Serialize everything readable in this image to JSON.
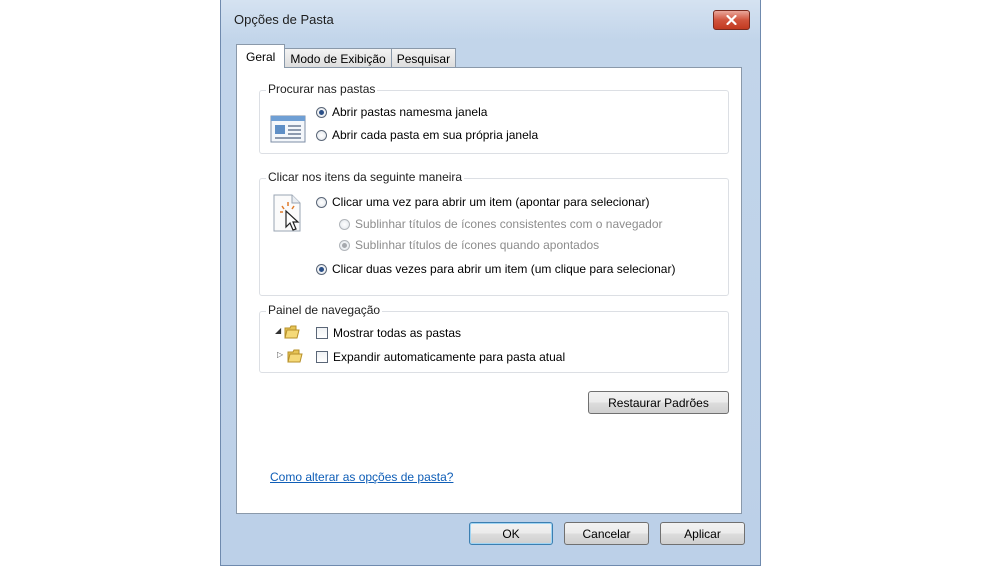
{
  "window": {
    "title": "Opções de Pasta"
  },
  "tabs": [
    {
      "label": "Geral",
      "active": true
    },
    {
      "label": "Modo de Exibição",
      "active": false
    },
    {
      "label": "Pesquisar",
      "active": false
    }
  ],
  "browse_group": {
    "title": "Procurar nas pastas",
    "options": [
      {
        "label": "Abrir pastas namesma janela",
        "selected": true
      },
      {
        "label": "Abrir cada pasta em sua própria janela",
        "selected": false
      }
    ]
  },
  "click_group": {
    "title": "Clicar nos itens da seguinte maneira",
    "single_click": {
      "label": "Clicar uma vez para abrir um item (apontar para selecionar)",
      "selected": false
    },
    "sub_options": [
      {
        "label": "Sublinhar títulos de ícones consistentes com o navegador",
        "selected": false
      },
      {
        "label": "Sublinhar títulos de ícones quando apontados",
        "selected": true
      }
    ],
    "double_click": {
      "label": "Clicar duas vezes para abrir um item (um clique para selecionar)",
      "selected": true
    }
  },
  "nav_group": {
    "title": "Painel de navegação",
    "options": [
      {
        "label": "Mostrar todas as pastas",
        "checked": false
      },
      {
        "label": "Expandir automaticamente para pasta atual",
        "checked": false
      }
    ]
  },
  "restore_button": "Restaurar Padrões",
  "help_link": "Como alterar as opções de pasta?",
  "footer": {
    "ok": "OK",
    "cancel": "Cancelar",
    "apply": "Aplicar"
  },
  "colors": {
    "link": "#0f5eb7",
    "close_button": "#c23a20",
    "titlebar": "#c2d5ea"
  }
}
